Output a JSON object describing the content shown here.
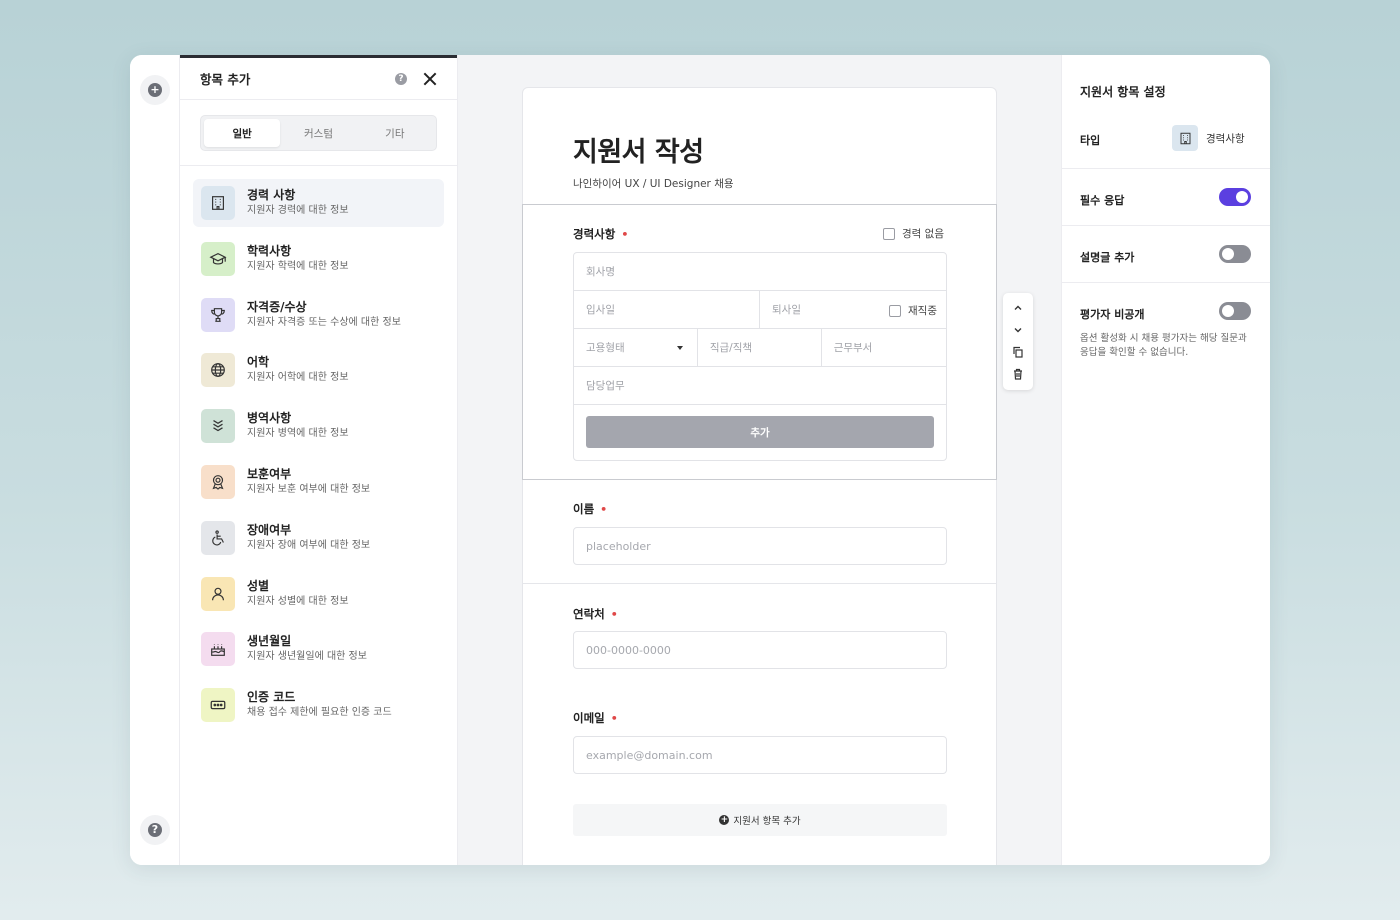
{
  "left_panel": {
    "title": "항목 추가",
    "tabs": [
      {
        "label": "일반",
        "active": true
      },
      {
        "label": "커스텀",
        "active": false
      },
      {
        "label": "기타",
        "active": false
      }
    ],
    "items": [
      {
        "title": "경력 사항",
        "desc": "지원자 경력에 대한 정보",
        "icon": "building-icon",
        "color": "#dbe6ef",
        "active": true
      },
      {
        "title": "학력사항",
        "desc": "지원자 학력에 대한 정보",
        "icon": "graduation-cap-icon",
        "color": "#d6efc9"
      },
      {
        "title": "자격증/수상",
        "desc": "지원자 자격증 또는 수상에 대한 정보",
        "icon": "trophy-icon",
        "color": "#dfdcf6"
      },
      {
        "title": "어학",
        "desc": "지원자 어학에 대한 정보",
        "icon": "globe-icon",
        "color": "#efe9d6"
      },
      {
        "title": "병역사항",
        "desc": "지원자 병역에 대한 정보",
        "icon": "rank-chevrons-icon",
        "color": "#cfe2d7"
      },
      {
        "title": "보훈여부",
        "desc": "지원자 보훈 여부에 대한 정보",
        "icon": "medal-icon",
        "color": "#f8dfca"
      },
      {
        "title": "장애여부",
        "desc": "지원자 장애 여부에 대한 정보",
        "icon": "wheelchair-icon",
        "color": "#e4e6ea"
      },
      {
        "title": "성별",
        "desc": "지원자 성별에 대한 정보",
        "icon": "person-icon",
        "color": "#f9e6b4"
      },
      {
        "title": "생년월일",
        "desc": "지원자 생년월일에 대한 정보",
        "icon": "cake-icon",
        "color": "#f4dcef"
      },
      {
        "title": "인증 코드",
        "desc": "채용 접수 제한에 필요한 인증 코드",
        "icon": "code-box-icon",
        "color": "#eff5c4"
      }
    ]
  },
  "form": {
    "title": "지원서 작성",
    "subtitle": "나인하이어 UX / UI Designer 채용",
    "career": {
      "label": "경력사항",
      "required_mark": "•",
      "no_career": "경력 없음",
      "company_placeholder": "회사명",
      "start_placeholder": "입사일",
      "end_placeholder": "퇴사일",
      "currently_employed": "재직중",
      "employment_type_placeholder": "고용형태",
      "position_placeholder": "직급/직책",
      "department_placeholder": "근무부서",
      "duties_placeholder": "담당업무",
      "add_button": "추가"
    },
    "name": {
      "label": "이름",
      "required_mark": "•",
      "placeholder": "placeholder"
    },
    "contact": {
      "label": "연락처",
      "required_mark": "•",
      "placeholder": "000-0000-0000"
    },
    "email": {
      "label": "이메일",
      "required_mark": "•",
      "placeholder": "example@domain.com"
    },
    "add_item_button": "지원서 항목 추가"
  },
  "block_toolbar": {
    "icons": [
      "move-up-icon",
      "move-down-icon",
      "copy-icon",
      "trash-icon"
    ]
  },
  "right_panel": {
    "title": "지원서 항목 설정",
    "type_label": "타입",
    "type_value": "경력사항",
    "required": {
      "label": "필수 응답",
      "on": true
    },
    "description": {
      "label": "설명글 추가",
      "on": false
    },
    "hide_from_evaluator": {
      "label": "평가자 비공개",
      "on": false,
      "help": "옵션 활성화 시 채용 평가자는 해당 질문과 응답을 확인할 수 없습니다."
    }
  },
  "colors": {
    "accent": "#5b3fe0",
    "required": "#e04848",
    "add_button": "#a4a6ae"
  }
}
